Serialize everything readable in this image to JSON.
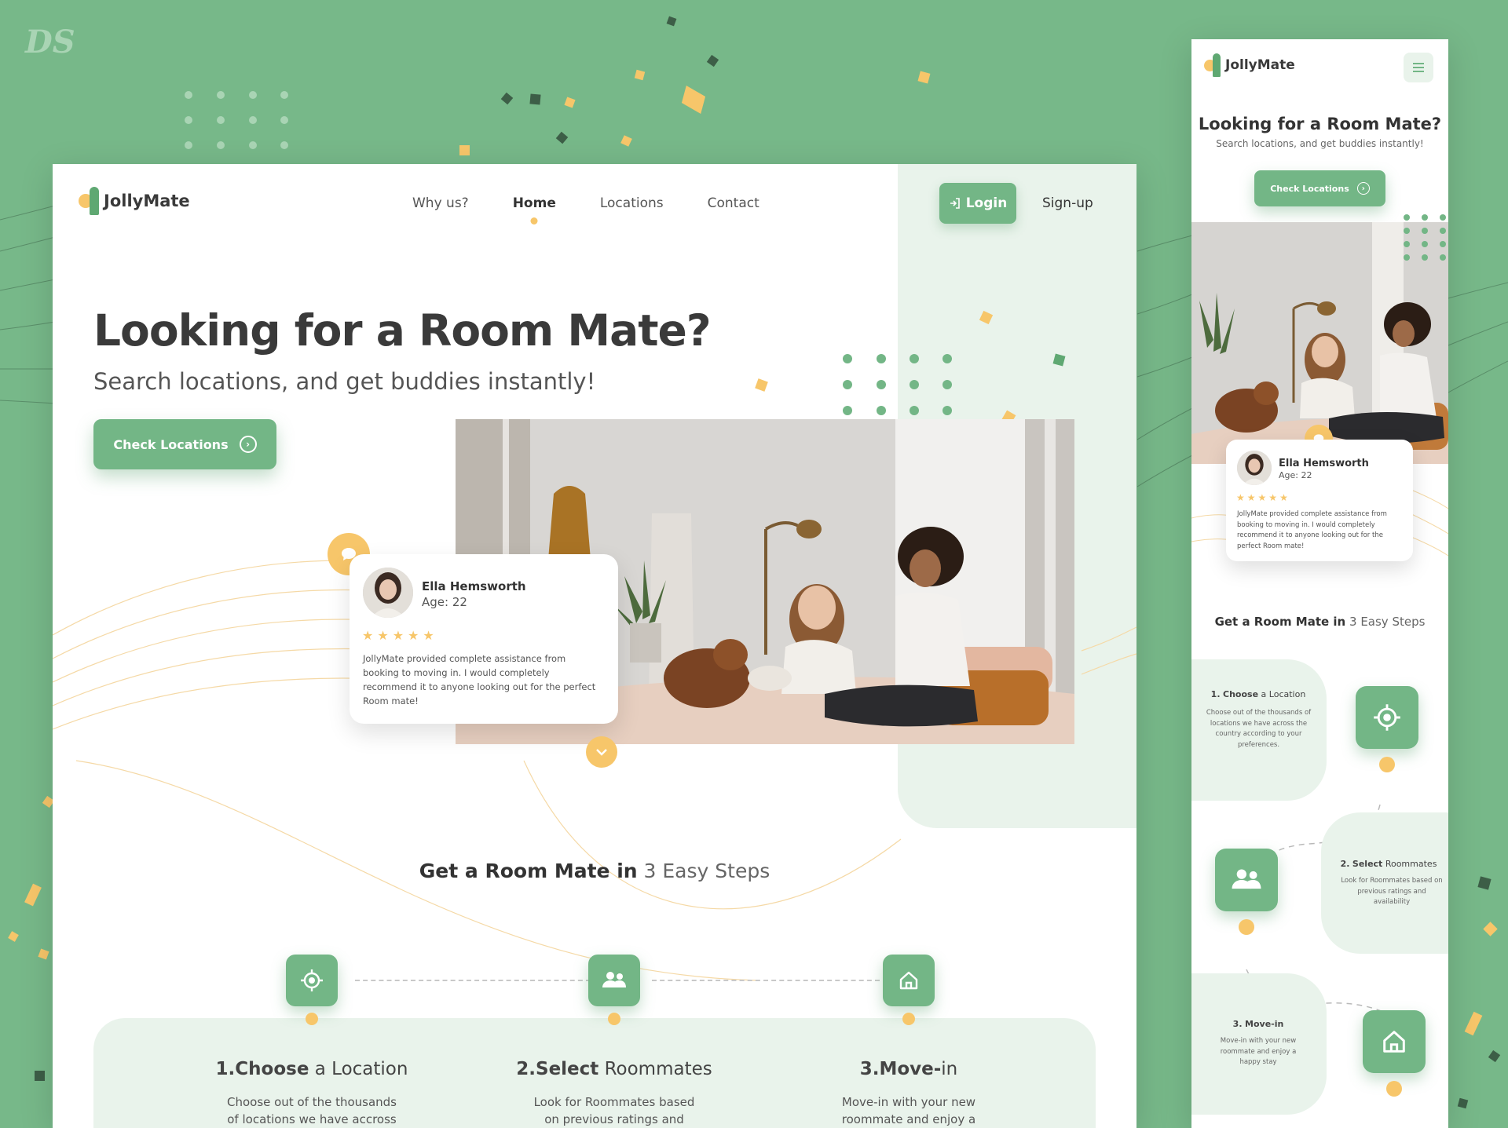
{
  "watermark": "DS",
  "colors": {
    "background": "#77b889",
    "accent_green": "#73b686",
    "accent_yellow": "#f7c66a",
    "panel_tint": "#e9f3eb"
  },
  "desktop": {
    "brand": "JollyMate",
    "nav": [
      {
        "label": "Why us?",
        "active": false
      },
      {
        "label": "Home",
        "active": true
      },
      {
        "label": "Locations",
        "active": false
      },
      {
        "label": "Contact",
        "active": false
      }
    ],
    "login_label": "Login",
    "signup_label": "Sign-up",
    "hero_title": "Looking for a Room Mate?",
    "hero_subtitle": "Search locations, and get buddies instantly!",
    "cta_label": "Check Locations",
    "review": {
      "name": "Ella Hemsworth",
      "age": "Age: 22",
      "rating": 5,
      "text": "JollyMate provided complete assistance from booking to moving in. I would completely recommend it to anyone looking out for the perfect Room mate!"
    },
    "steps_title_bold": "Get a Room Mate in",
    "steps_title_light": "3 Easy Steps",
    "steps": [
      {
        "num": "1.",
        "bold": "Choose",
        "light": "a Location",
        "icon": "target-icon",
        "desc_1": "Choose out of the thousands",
        "desc_2": "of locations we have accross"
      },
      {
        "num": "2.",
        "bold": "Select",
        "light": "Roommates",
        "icon": "users-icon",
        "desc_1": "Look for Roommates based",
        "desc_2": "on previous ratings and"
      },
      {
        "num": "3.",
        "bold": "Move-",
        "light": "in",
        "icon": "home-icon",
        "desc_1": "Move-in with your new",
        "desc_2": "roommate and enjoy a"
      }
    ]
  },
  "mobile": {
    "brand": "JollyMate",
    "hero_title": "Looking for a Room Mate?",
    "hero_subtitle": "Search locations, and get buddies instantly!",
    "cta_label": "Check Locations",
    "review": {
      "name": "Ella Hemsworth",
      "age": "Age: 22",
      "rating": 5,
      "text": "JollyMate provided complete assistance from booking to moving in. I would completely recommend it to anyone looking out for the perfect Room mate!"
    },
    "steps_title_bold": "Get a Room Mate in",
    "steps_title_light": "3 Easy Steps",
    "steps": [
      {
        "num": "1.",
        "bold": "Choose",
        "light": "a Location",
        "desc": "Choose out of the thousands of locations we have across the country according to your preferences."
      },
      {
        "num": "2.",
        "bold": "Select",
        "light": "Roommates",
        "desc": "Look for Roommates based on previous ratings and availability"
      },
      {
        "num": "3.",
        "bold": "Move-in",
        "light": "",
        "desc": "Move-in with your new roommate and enjoy a happy stay"
      }
    ]
  }
}
